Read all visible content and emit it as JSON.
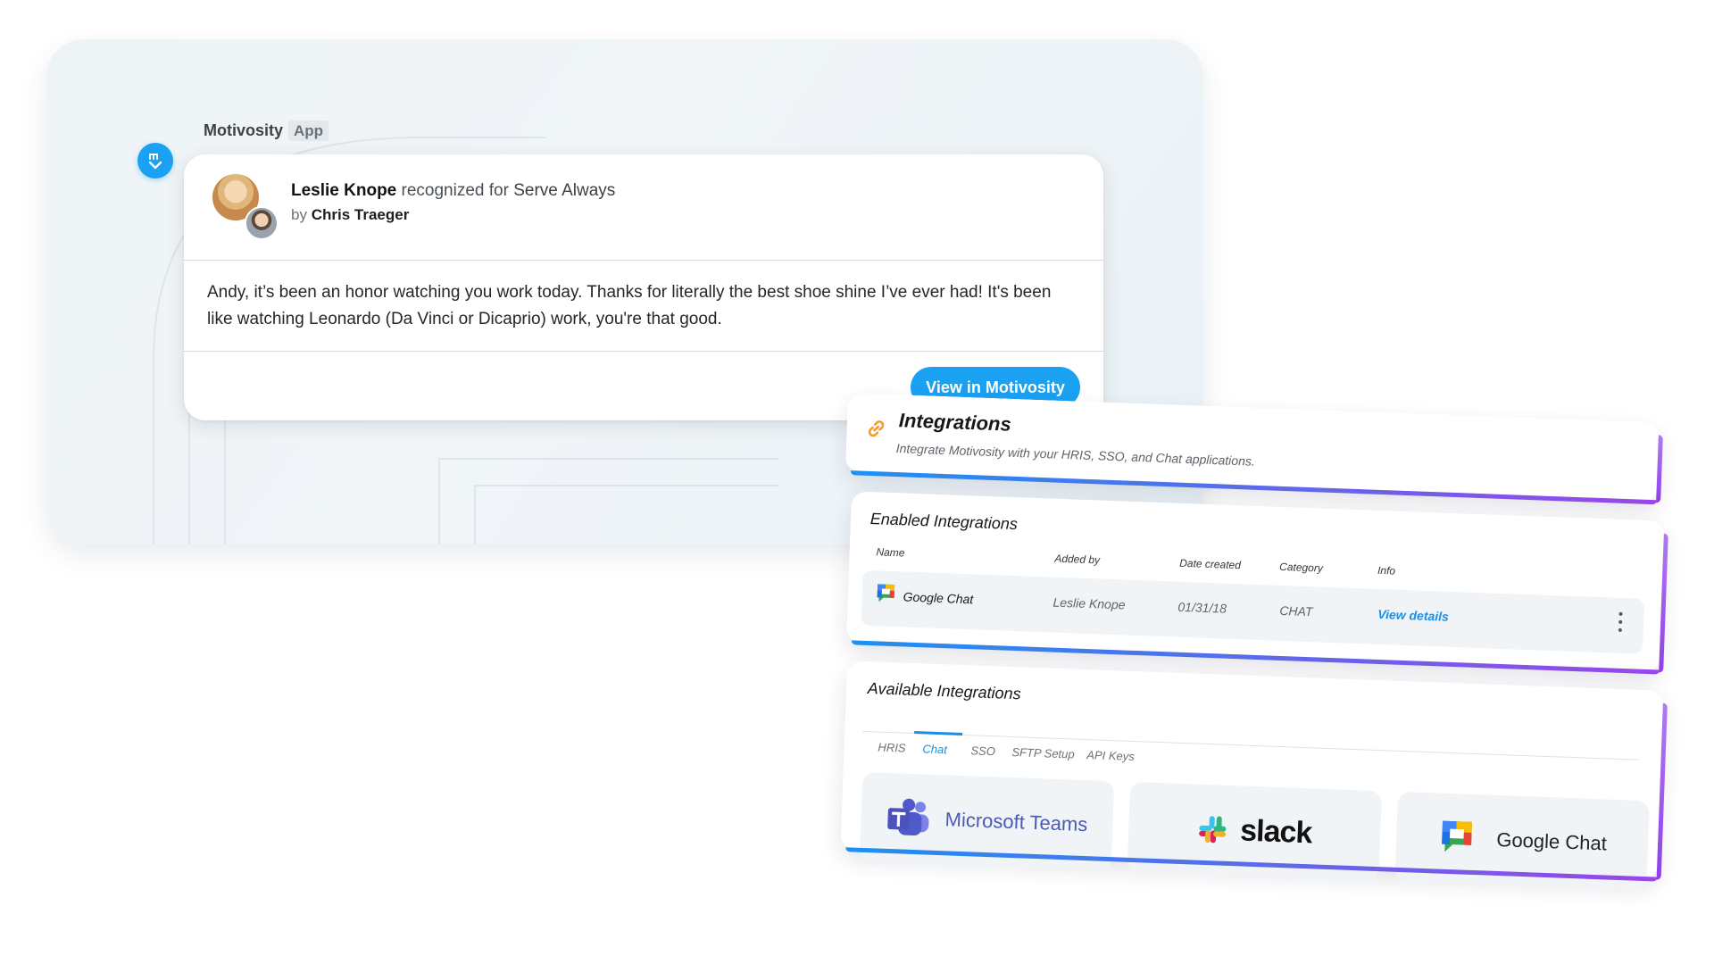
{
  "chat": {
    "sender": "Motivosity",
    "app_tag": "App",
    "recipient": "Leslie Knope",
    "recognized_text": "recognized for",
    "value": "Serve Always",
    "by_prefix": "by",
    "giver": "Chris Traeger",
    "message": "Andy, it’s been an honor watching you work today. Thanks for literally the best shoe shine I’ve ever had! It's been like watching Leonardo (Da Vinci or Dicaprio) work, you're that good.",
    "button_label": "View in Motivosity"
  },
  "integrations": {
    "title": "Integrations",
    "subtitle": "Integrate Motivosity with your HRIS, SSO, and Chat applications.",
    "enabled": {
      "title": "Enabled Integrations",
      "columns": [
        "Name",
        "Added by",
        "Date created",
        "Category",
        "Info"
      ],
      "row": {
        "name": "Google Chat",
        "added_by": "Leslie Knope",
        "date_created": "01/31/18",
        "category": "CHAT",
        "info_link": "View details"
      }
    },
    "available": {
      "title": "Available Integrations",
      "tabs": [
        "HRIS",
        "Chat",
        "SSO",
        "SFTP Setup",
        "API Keys"
      ],
      "active_tab": "Chat",
      "tiles": [
        "Microsoft Teams",
        "slack",
        "Google Chat"
      ]
    }
  },
  "colors": {
    "accent_blue": "#1ba1f2",
    "link_blue": "#1b8fe6",
    "gradient_purple": "#9a46e8",
    "link_icon_orange": "#f39a2b"
  },
  "icons": {
    "bot": "motivosity-logo-icon",
    "link": "link-icon",
    "google_chat": "google-chat-icon",
    "teams": "microsoft-teams-icon",
    "slack": "slack-icon",
    "kebab": "more-vertical-icon"
  }
}
